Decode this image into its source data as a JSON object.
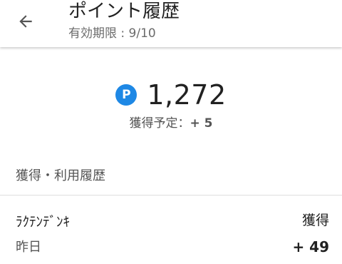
{
  "header": {
    "back_icon": "arrow-left-icon",
    "title": "ポイント履歴",
    "subtitle": "有効期限 : 9/10"
  },
  "balance": {
    "badge_letter": "P",
    "badge_icon": "point-p-icon",
    "badge_color": "#1e88e5",
    "value": "1,272",
    "pending_label": "獲得予定：",
    "pending_value": "+ 5"
  },
  "history": {
    "section_title": "獲得・利用履歴",
    "items": [
      {
        "name": "ﾗｸﾃﾝﾃﾞﾝｷ",
        "date": "昨日",
        "type": "獲得",
        "amount": "+ 49"
      }
    ]
  }
}
